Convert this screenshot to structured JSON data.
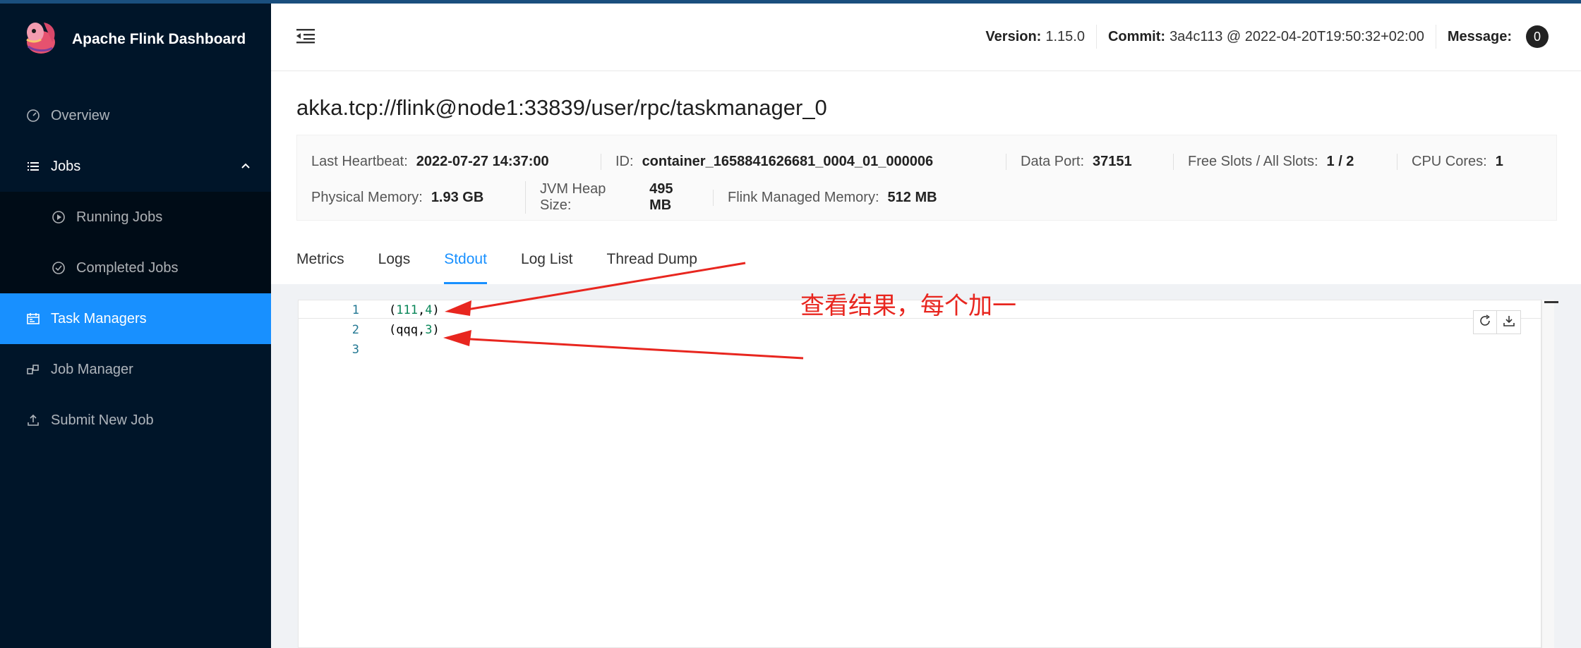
{
  "app": {
    "title": "Apache Flink Dashboard"
  },
  "sidebar": {
    "items": [
      {
        "label": "Overview"
      },
      {
        "label": "Jobs"
      },
      {
        "label": "Running Jobs"
      },
      {
        "label": "Completed Jobs"
      },
      {
        "label": "Task Managers"
      },
      {
        "label": "Job Manager"
      },
      {
        "label": "Submit New Job"
      }
    ]
  },
  "header": {
    "version_label": "Version:",
    "version": "1.15.0",
    "commit_label": "Commit:",
    "commit": "3a4c113 @ 2022-04-20T19:50:32+02:00",
    "message_label": "Message:",
    "message_count": "0"
  },
  "page": {
    "title": "akka.tcp://flink@node1:33839/user/rpc/taskmanager_0"
  },
  "info": {
    "row1": [
      {
        "label": "Last Heartbeat:",
        "value": "2022-07-27 14:37:00"
      },
      {
        "label": "ID:",
        "value": "container_1658841626681_0004_01_000006"
      },
      {
        "label": "Data Port:",
        "value": "37151"
      },
      {
        "label": "Free Slots / All Slots:",
        "value": "1 / 2"
      },
      {
        "label": "CPU Cores:",
        "value": "1"
      }
    ],
    "row2": [
      {
        "label": "Physical Memory:",
        "value": "1.93 GB"
      },
      {
        "label": "JVM Heap Size:",
        "value": "495 MB"
      },
      {
        "label": "Flink Managed Memory:",
        "value": "512 MB"
      }
    ]
  },
  "tabs": [
    {
      "label": "Metrics"
    },
    {
      "label": "Logs"
    },
    {
      "label": "Stdout"
    },
    {
      "label": "Log List"
    },
    {
      "label": "Thread Dump"
    }
  ],
  "editor": {
    "lines": [
      {
        "n": "1",
        "open": "(",
        "a": "111",
        "sep": ",",
        "b": "4",
        "close": ")"
      },
      {
        "n": "2",
        "open": "(",
        "a": "qqq",
        "sep": ",",
        "b": "3",
        "close": ")"
      },
      {
        "n": "3"
      }
    ]
  },
  "annotation": {
    "text": "查看结果，每个加一",
    "color": "#e8261f"
  },
  "colors": {
    "sidebar_bg": "#001529",
    "accent": "#1890ff"
  }
}
